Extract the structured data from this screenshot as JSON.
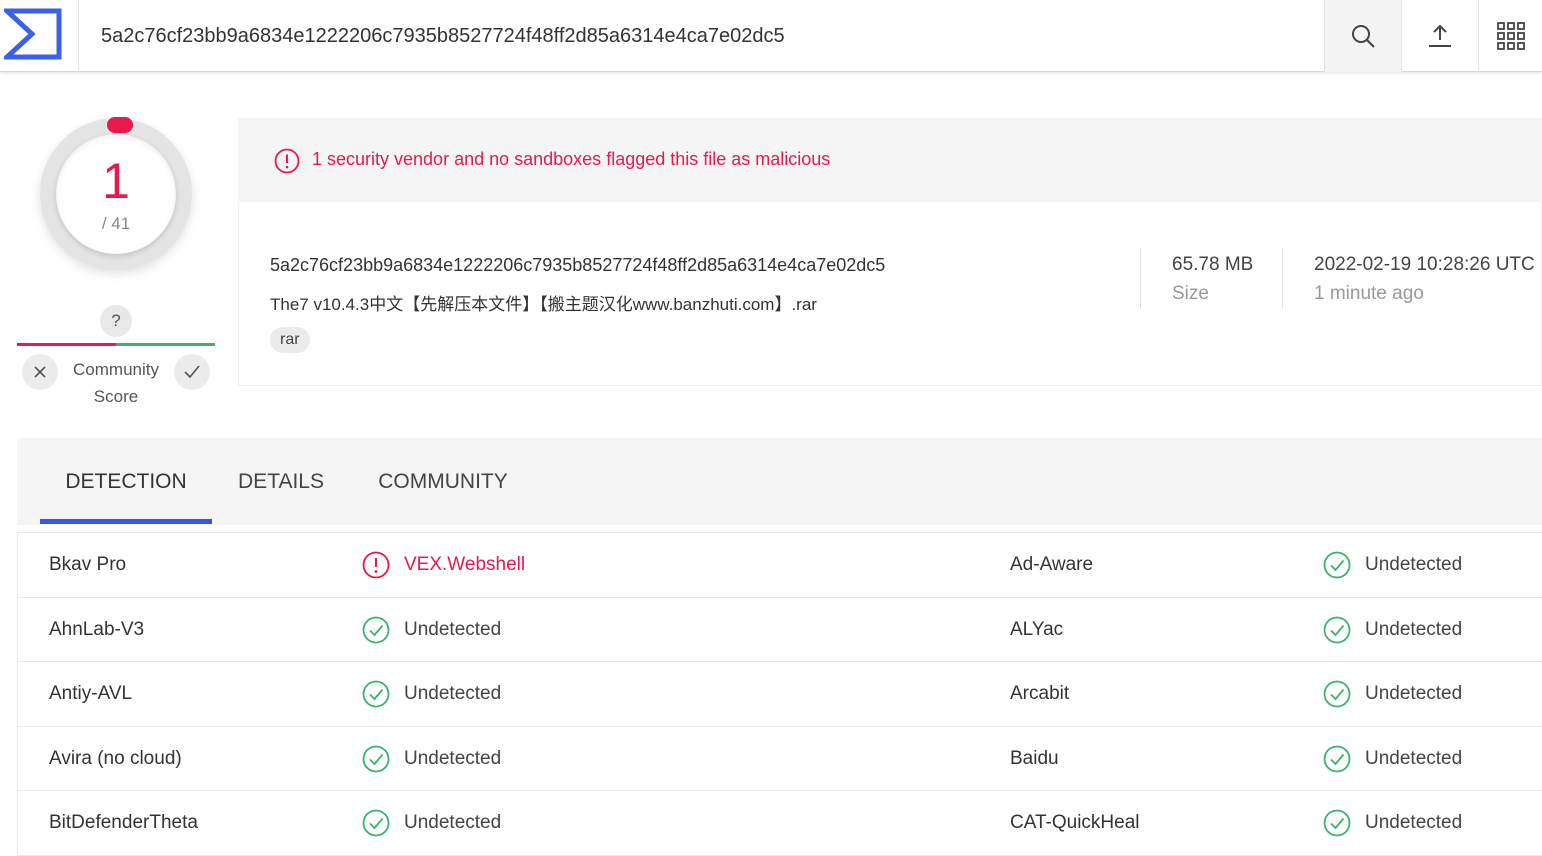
{
  "header": {
    "search_value": "5a2c76cf23bb9a6834e1222206c7935b8527724f48ff2d85a6314e4ca7e02dc5",
    "icons": [
      "virustotal-logo",
      "search-icon",
      "upload-icon",
      "apps-grid-icon"
    ]
  },
  "score": {
    "detections": "1",
    "total": "/ 41",
    "community_unknown": "?",
    "community_label": "Community Score"
  },
  "alert": {
    "text": "1 security vendor and no sandboxes flagged this file as malicious"
  },
  "file": {
    "hash": "5a2c76cf23bb9a6834e1222206c7935b8527724f48ff2d85a6314e4ca7e02dc5",
    "name": "The7 v10.4.3中文【先解压本文件】【搬主题汉化www.banzhuti.com】.rar",
    "tag": "rar",
    "size_value": "65.78 MB",
    "size_label": "Size",
    "date_value": "2022-02-19 10:28:26 UTC",
    "date_label": "1 minute ago"
  },
  "tabs": [
    {
      "label": "DETECTION",
      "active": true
    },
    {
      "label": "DETAILS",
      "active": false
    },
    {
      "label": "COMMUNITY",
      "active": false
    }
  ],
  "colors": {
    "malicious": "#e8194c",
    "clean": "#3bb36b",
    "accent": "#3a59e2"
  },
  "results": [
    [
      {
        "engine": "Bkav Pro",
        "result": "VEX.Webshell",
        "malicious": true
      },
      {
        "engine": "Ad-Aware",
        "result": "Undetected",
        "malicious": false
      }
    ],
    [
      {
        "engine": "AhnLab-V3",
        "result": "Undetected",
        "malicious": false
      },
      {
        "engine": "ALYac",
        "result": "Undetected",
        "malicious": false
      }
    ],
    [
      {
        "engine": "Antiy-AVL",
        "result": "Undetected",
        "malicious": false
      },
      {
        "engine": "Arcabit",
        "result": "Undetected",
        "malicious": false
      }
    ],
    [
      {
        "engine": "Avira (no cloud)",
        "result": "Undetected",
        "malicious": false
      },
      {
        "engine": "Baidu",
        "result": "Undetected",
        "malicious": false
      }
    ],
    [
      {
        "engine": "BitDefenderTheta",
        "result": "Undetected",
        "malicious": false
      },
      {
        "engine": "CAT-QuickHeal",
        "result": "Undetected",
        "malicious": false
      }
    ]
  ]
}
